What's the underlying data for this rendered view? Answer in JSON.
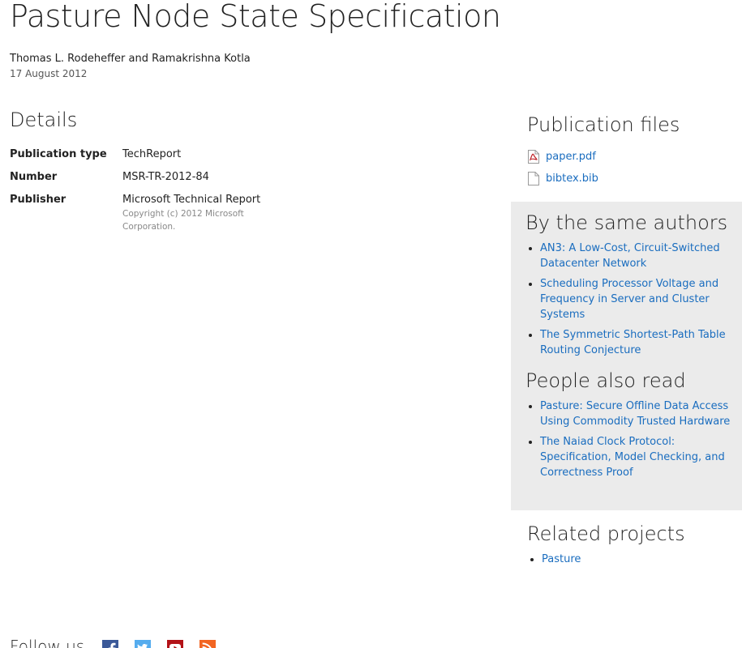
{
  "title": "Pasture Node State Specification",
  "authors": "Thomas L. Rodeheffer and Ramakrishna Kotla",
  "date": "17 August 2012",
  "details": {
    "heading": "Details",
    "rows": [
      {
        "label": "Publication type",
        "value": "TechReport"
      },
      {
        "label": "Number",
        "value": "MSR-TR-2012-84"
      },
      {
        "label": "Publisher",
        "value": "Microsoft Technical Report",
        "note": "Copyright (c) 2012 Microsoft Corporation."
      }
    ]
  },
  "publication_files": {
    "heading": "Publication files",
    "files": [
      {
        "name": "paper.pdf",
        "icon": "pdf-file-icon"
      },
      {
        "name": "bibtex.bib",
        "icon": "document-icon"
      }
    ]
  },
  "same_authors": {
    "heading": "By the same authors",
    "items": [
      "AN3: A Low-Cost, Circuit-Switched Datacenter Network",
      "Scheduling Processor Voltage and Frequency in Server and Cluster Systems",
      "The Symmetric Shortest-Path Table Routing Conjecture"
    ]
  },
  "also_read": {
    "heading": "People also read",
    "items": [
      "Pasture: Secure Offline Data Access Using Commodity Trusted Hardware",
      "The Naiad Clock Protocol: Specification, Model Checking, and Correctness Proof"
    ]
  },
  "related_projects": {
    "heading": "Related projects",
    "items": [
      "Pasture"
    ]
  },
  "follow": {
    "label": "Follow us",
    "icons": [
      "facebook-icon",
      "twitter-icon",
      "youtube-icon",
      "rss-icon"
    ]
  },
  "colors": {
    "link": "#1a6dbf",
    "sidebar_bg": "#ebebeb",
    "facebook": "#3b5998",
    "twitter": "#55acee",
    "youtube": "#b31217",
    "rss": "#f26522"
  }
}
